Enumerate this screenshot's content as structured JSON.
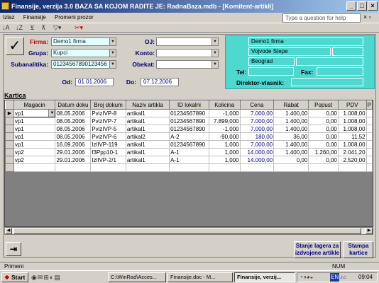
{
  "window": {
    "title": "Finansije, verzija 3.0       BAZA SA KOJOM RADITE JE: RadnaBaza.mdb - [Komitent-artikli]"
  },
  "menu": [
    "Izlaz",
    "Finansije",
    "Promeni prozor"
  ],
  "help_placeholder": "Type a question for help",
  "form": {
    "firma_label": "Firma:",
    "firma_value": "Demo1 firma",
    "grupa_label": "Grupa:",
    "grupa_value": "Kupci",
    "subanalitika_label": "Subanalitika:",
    "subanalitika_value": "01234567890123456",
    "oj_label": "OJ:",
    "konto_label": "Konto:",
    "obekat_label": "Obekat:",
    "od_label": "Od:",
    "od_value": "01.01.2006",
    "do_label": "Do:",
    "do_value": "07.12.2006"
  },
  "info": {
    "firma": "Demo1 firma",
    "adresa": "Vojvode Stepe",
    "grad": "Beograd",
    "tel_label": "Tel:",
    "fax_label": "Fax:",
    "direktor_label": "Direktor-vlasnik:"
  },
  "section_title": "Kartica",
  "table": {
    "columns": [
      "Magacin",
      "Datum doku",
      "Broj dokum",
      "Naziv artikla",
      "ID lokalni",
      "Kolicina",
      "Cena",
      "Rabat",
      "Popust",
      "PDV",
      "P"
    ],
    "rows": [
      [
        "vp1",
        "08.05.2006",
        "PvizIVP-8",
        "artikal1",
        "01234567890",
        "-1,000",
        "7.000,00",
        "1.400,00",
        "0,00",
        "1.008,00",
        ""
      ],
      [
        "vp1",
        "08.05.2006",
        "PvizIVP-7",
        "artikal1",
        "01234567890",
        "7.899,000",
        "7.000,00",
        "1.400,00",
        "0,00",
        "1.008,00",
        ""
      ],
      [
        "vp1",
        "08.05.2006",
        "PvizIVP-5",
        "artikal1",
        "01234567890",
        "-1,000",
        "7.000,00",
        "1.400,00",
        "0,00",
        "1.008,00",
        ""
      ],
      [
        "vp1",
        "08.05.2006",
        "PvizIVP-6",
        "artikal2",
        "A-2",
        "-90,000",
        "180,00",
        "36,00",
        "0,00",
        "11,52",
        ""
      ],
      [
        "vp1",
        "16.09.2006",
        "IzlIVP-119",
        "artikal1",
        "01234567890",
        "1,000",
        "7.000,00",
        "1.400,00",
        "0,00",
        "1.008,00",
        ""
      ],
      [
        "vp2",
        "29.01.2006",
        "f3Ppp10-1",
        "artikal1",
        "A-1",
        "1,000",
        "14.000,00",
        "1.400,00",
        "1.260,00",
        "2.041,20",
        ""
      ],
      [
        "vp2",
        "29.01.2006",
        "IzlIVP-2/1",
        "artikal1",
        "A-1",
        "1,000",
        "14.000,00",
        "0,00",
        "0,00",
        "2.520,00",
        ""
      ]
    ],
    "empty_rows": 1
  },
  "buttons": {
    "stanje": "Stanje lagera za izdvojene artikle",
    "stampa": "Stampa kartice"
  },
  "status": {
    "left": "Primeni",
    "right": "NUM"
  },
  "taskbar": {
    "start": "Start",
    "tasks": [
      "C:\\WinRad\\Acces...",
      "Finansije.doc - M...",
      "Finansije, verzij..."
    ],
    "lang": "EN",
    "clock": "09:04"
  },
  "colors": {
    "accent_teal": "#4dd8d0",
    "combo_bg": "#e0ffff",
    "title_bar": "#0a246a"
  }
}
